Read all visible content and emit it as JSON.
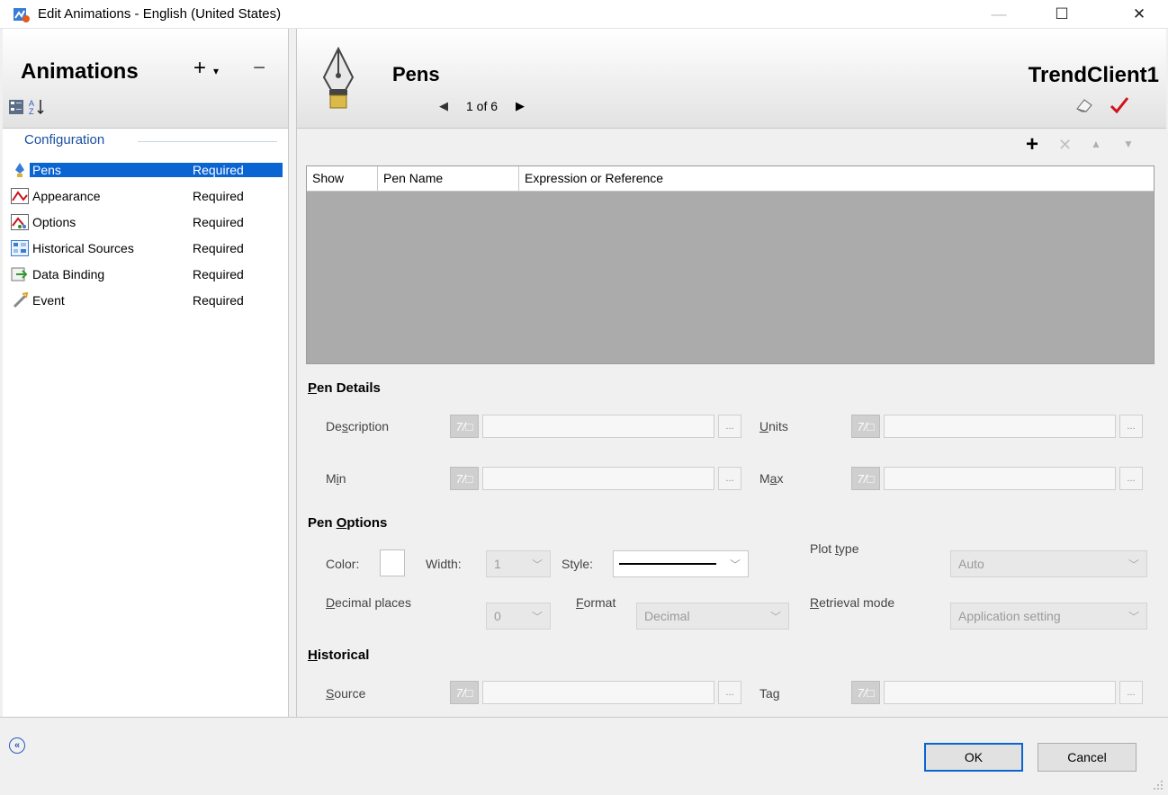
{
  "window": {
    "title": "Edit Animations - English (United States)",
    "minimize": "—",
    "maximize": "☐",
    "close": "✕"
  },
  "left": {
    "title": "Animations",
    "add_label": "+",
    "add_dropdown": "▾",
    "remove_label": "−",
    "section_label": "Configuration",
    "items": [
      {
        "name": "Pens",
        "status": "Required",
        "icon": "pen-icon"
      },
      {
        "name": "Appearance",
        "status": "Required",
        "icon": "appearance-icon"
      },
      {
        "name": "Options",
        "status": "Required",
        "icon": "options-icon"
      },
      {
        "name": "Historical Sources",
        "status": "Required",
        "icon": "historical-sources-icon"
      },
      {
        "name": "Data Binding",
        "status": "Required",
        "icon": "data-binding-icon"
      },
      {
        "name": "Event",
        "status": "Required",
        "icon": "event-icon"
      }
    ]
  },
  "header": {
    "title": "Pens",
    "pager": "1 of 6",
    "client": "TrendClient1"
  },
  "table": {
    "columns": [
      "Show",
      "Pen Name",
      "Expression or Reference"
    ]
  },
  "pen_details": {
    "title_u": "P",
    "title_rest": "en Details",
    "description": {
      "pre": "De",
      "u": "s",
      "post": "cription"
    },
    "units": {
      "pre": "",
      "u": "U",
      "post": "nits"
    },
    "min": {
      "pre": "M",
      "u": "i",
      "post": "n"
    },
    "max": {
      "pre": "M",
      "u": "a",
      "post": "x"
    }
  },
  "pen_options": {
    "title_pre": "Pen ",
    "title_u": "O",
    "title_rest": "ptions",
    "color_label": "Color:",
    "width_label": "Width:",
    "width_value": "1",
    "style_label": "Style:",
    "plot_type": {
      "pre": "Plot ",
      "u": "t",
      "post": "ype"
    },
    "plot_type_value": "Auto",
    "decimal_places": {
      "pre": "",
      "u": "D",
      "post": "ecimal places"
    },
    "decimal_value": "0",
    "format": {
      "pre": "",
      "u": "F",
      "post": "ormat"
    },
    "format_value": "Decimal",
    "retrieval_mode": {
      "pre": "",
      "u": "R",
      "post": "etrieval mode"
    },
    "retrieval_value": "Application setting"
  },
  "historical": {
    "title_u": "H",
    "title_rest": "istorical",
    "source": {
      "pre": "",
      "u": "S",
      "post": "ource"
    },
    "tag": {
      "pre": "Ta",
      "u": "g",
      "post": ""
    }
  },
  "buttons": {
    "ok": "OK",
    "cancel": "Cancel",
    "dots": "..."
  },
  "colors": {
    "accent": "#0a64d2",
    "checkmark": "#d0121b"
  }
}
